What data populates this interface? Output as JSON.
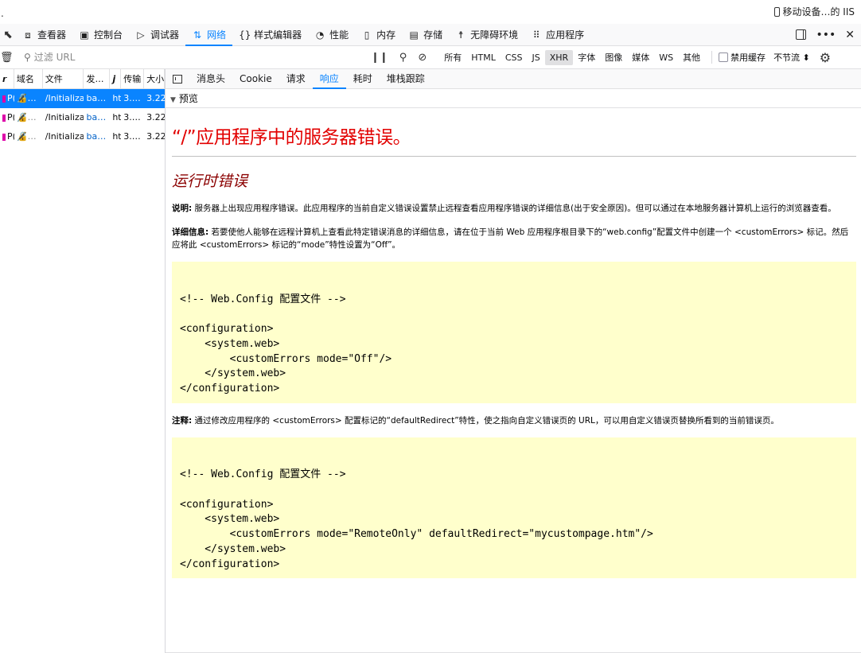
{
  "window": {
    "corner_text": ".",
    "responsive_label": "移动设备…的 IIS"
  },
  "toolbar": {
    "tabs": [
      {
        "label": "查看器",
        "icon": "inspector-icon"
      },
      {
        "label": "控制台",
        "icon": "console-icon"
      },
      {
        "label": "调试器",
        "icon": "debugger-icon"
      },
      {
        "label": "网络",
        "icon": "network-icon",
        "active": true
      },
      {
        "label": "样式编辑器",
        "icon": "style-editor-icon"
      },
      {
        "label": "性能",
        "icon": "performance-icon"
      },
      {
        "label": "内存",
        "icon": "memory-icon"
      },
      {
        "label": "存储",
        "icon": "storage-icon"
      },
      {
        "label": "无障碍环境",
        "icon": "accessibility-icon"
      },
      {
        "label": "应用程序",
        "icon": "application-icon"
      }
    ]
  },
  "filter": {
    "placeholder": "过滤 URL",
    "types": [
      "所有",
      "HTML",
      "CSS",
      "JS",
      "XHR",
      "字体",
      "图像",
      "媒体",
      "WS",
      "其他"
    ],
    "active_type": "XHR",
    "disable_cache_label": "禁用缓存",
    "throttle_label": "不节流 ⬍"
  },
  "requests": {
    "columns": [
      "𝙧",
      "域名",
      "文件",
      "发…",
      "𝙟",
      "传输",
      "大小"
    ],
    "rows": [
      {
        "method": "P(",
        "domain": "…",
        "file": "/Initializa",
        "initiator": "ba…",
        "type": "ht",
        "transferred": "3.…",
        "size": "3.22",
        "selected": true
      },
      {
        "method": "P(",
        "domain": "…",
        "file": "/Initializa",
        "initiator": "ba…",
        "type": "ht",
        "transferred": "3.…",
        "size": "3.22",
        "selected": false
      },
      {
        "method": "P(",
        "domain": "…",
        "file": "/Initializa",
        "initiator": "ba…",
        "type": "ht",
        "transferred": "3.…",
        "size": "3.22",
        "selected": false
      }
    ]
  },
  "details": {
    "tabs": [
      "消息头",
      "Cookie",
      "请求",
      "响应",
      "耗时",
      "堆栈跟踪"
    ],
    "active_tab": "响应",
    "preview_label": "预览"
  },
  "preview": {
    "title": "“/”应用程序中的服务器错误。",
    "subtitle": "运行时错误",
    "desc_label": "说明:",
    "desc_text": " 服务器上出现应用程序错误。此应用程序的当前自定义错误设置禁止远程查看应用程序错误的详细信息(出于安全原因)。但可以通过在本地服务器计算机上运行的浏览器查看。",
    "details_label": "详细信息:",
    "details_text": " 若要使他人能够在远程计算机上查看此特定错误消息的详细信息，请在位于当前 Web 应用程序根目录下的“web.config”配置文件中创建一个 <customErrors> 标记。然后应将此 <customErrors> 标记的“mode”特性设置为“Off”。",
    "code1": "\n<!-- Web.Config 配置文件 -->\n\n<configuration>\n    <system.web>\n        <customErrors mode=\"Off\"/>\n    </system.web>\n</configuration>",
    "note_label": "注释:",
    "note_text": " 通过修改应用程序的 <customErrors> 配置标记的“defaultRedirect”特性，使之指向自定义错误页的 URL，可以用自定义错误页替换所看到的当前错误页。",
    "code2": "\n<!-- Web.Config 配置文件 -->\n\n<configuration>\n    <system.web>\n        <customErrors mode=\"RemoteOnly\" defaultRedirect=\"mycustompage.htm\"/>\n    </system.web>\n</configuration>"
  }
}
